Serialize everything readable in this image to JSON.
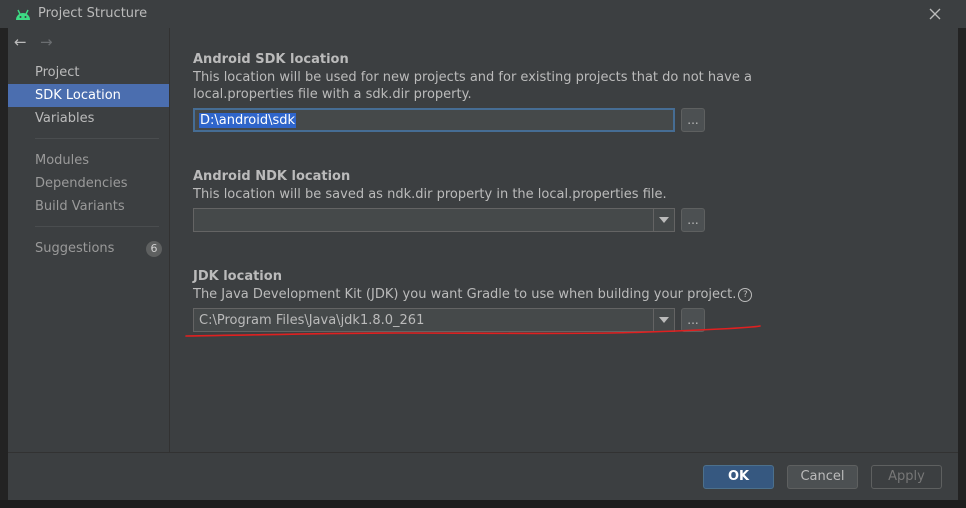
{
  "window": {
    "title": "Project Structure",
    "icon": "android-icon",
    "close_icon": "close-icon"
  },
  "sidebar": {
    "nav_back_glyph": "←",
    "nav_forward_glyph": "→",
    "items": [
      {
        "label": "Project"
      },
      {
        "label": "SDK Location"
      },
      {
        "label": "Variables"
      },
      {
        "label": "Modules"
      },
      {
        "label": "Dependencies"
      },
      {
        "label": "Build Variants"
      },
      {
        "label": "Suggestions",
        "badge": "6"
      }
    ]
  },
  "sdk": {
    "title": "Android SDK location",
    "description_line1": "This location will be used for new projects and for existing projects that do not have a",
    "description_line2": "local.properties file with a sdk.dir property.",
    "value": "D:\\android\\sdk",
    "browse_label": "..."
  },
  "ndk": {
    "title": "Android NDK location",
    "description": "This location will be saved as ndk.dir property in the local.properties file.",
    "value": "",
    "browse_label": "..."
  },
  "jdk": {
    "title": "JDK location",
    "description": "The Java Development Kit (JDK) you want Gradle to use when building your project.",
    "help_glyph": "?",
    "value": "C:\\Program Files\\Java\\jdk1.8.0_261",
    "browse_label": "..."
  },
  "footer": {
    "ok_label": "OK",
    "cancel_label": "Cancel",
    "apply_label": "Apply"
  },
  "colors": {
    "accent": "#4b6eaf",
    "annotation_red": "#e02020"
  }
}
